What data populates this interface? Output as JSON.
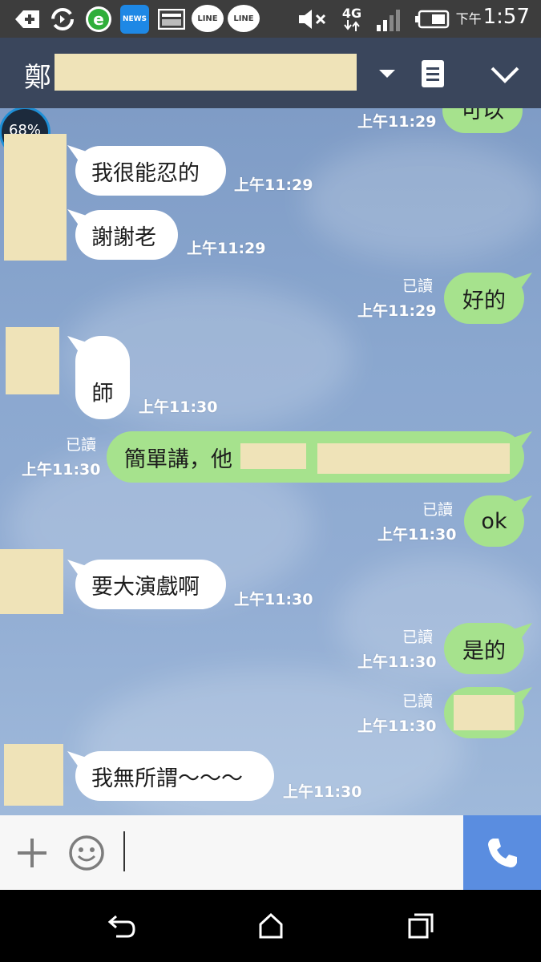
{
  "status_bar": {
    "app_icons": [
      "add-icon",
      "sync-icon",
      "browser-e-icon",
      "news-app-icon",
      "screenshot-icon",
      "line-icon",
      "line-icon"
    ],
    "news_label": "NEWS",
    "line_label_1": "LINE",
    "line_label_2": "LINE",
    "network": "4G",
    "clock_ampm": "下午",
    "clock_time": "1:57"
  },
  "header": {
    "title_char": "鄭"
  },
  "chat": {
    "top_partial": {
      "time": "上午11:29",
      "text": "可以"
    },
    "badge": "68%",
    "messages": [
      {
        "dir": "in",
        "text": "我很能忍的",
        "time": "上午11:29"
      },
      {
        "dir": "in",
        "text": "謝謝老",
        "time": "上午11:29"
      },
      {
        "dir": "out",
        "text": "好的",
        "time": "上午11:29",
        "read": "已讀"
      },
      {
        "dir": "in",
        "text": "師",
        "time": "上午11:30"
      },
      {
        "dir": "out",
        "text": "簡單講，他",
        "time": "上午11:30",
        "read": "已讀"
      },
      {
        "dir": "out",
        "text": "ok",
        "time": "上午11:30",
        "read": "已讀"
      },
      {
        "dir": "in",
        "text": "要大演戲啊",
        "time": "上午11:30"
      },
      {
        "dir": "out",
        "text": "是的",
        "time": "上午11:30",
        "read": "已讀"
      },
      {
        "dir": "out",
        "text": "",
        "time": "上午11:30",
        "read": "已讀"
      },
      {
        "dir": "in",
        "text": "我無所謂～～～",
        "time": "上午11:30"
      }
    ]
  },
  "colors": {
    "header_bg": "#3a465c",
    "incoming_bubble": "#ffffff",
    "outgoing_bubble": "#a6e28d",
    "call_button": "#5a8de0",
    "redaction": "#efe3b8"
  }
}
